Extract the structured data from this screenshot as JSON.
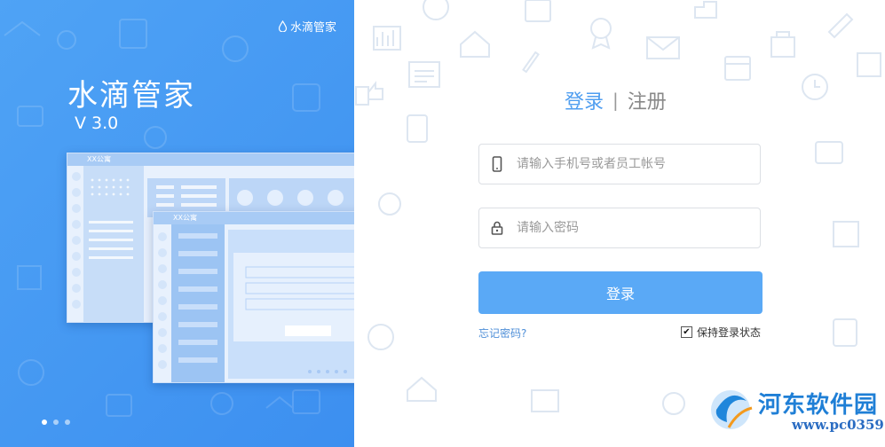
{
  "left_panel": {
    "brand_small": "水滴管家",
    "app_title": "水滴管家",
    "version": "V 3.0",
    "mock_window_back_title": "XX公寓",
    "mock_window_front_title": "XX公寓",
    "carousel_dots": 3,
    "active_dot": 1
  },
  "login_form": {
    "tab_login": "登录",
    "tab_separator": "|",
    "tab_register": "注册",
    "phone_placeholder": "请输入手机号或者员工帐号",
    "password_placeholder": "请输入密码",
    "login_button": "登录",
    "forgot_password": "忘记密码?",
    "remember_label": "保持登录状态",
    "remember_checked": true
  },
  "watermark": {
    "name": "河东软件园",
    "url": "www.pc0359.cn"
  },
  "colors": {
    "left_bg": "#4099f2",
    "accent": "#5aa9f6",
    "tab_active": "#4f9ef0",
    "link": "#4f8fd8"
  }
}
